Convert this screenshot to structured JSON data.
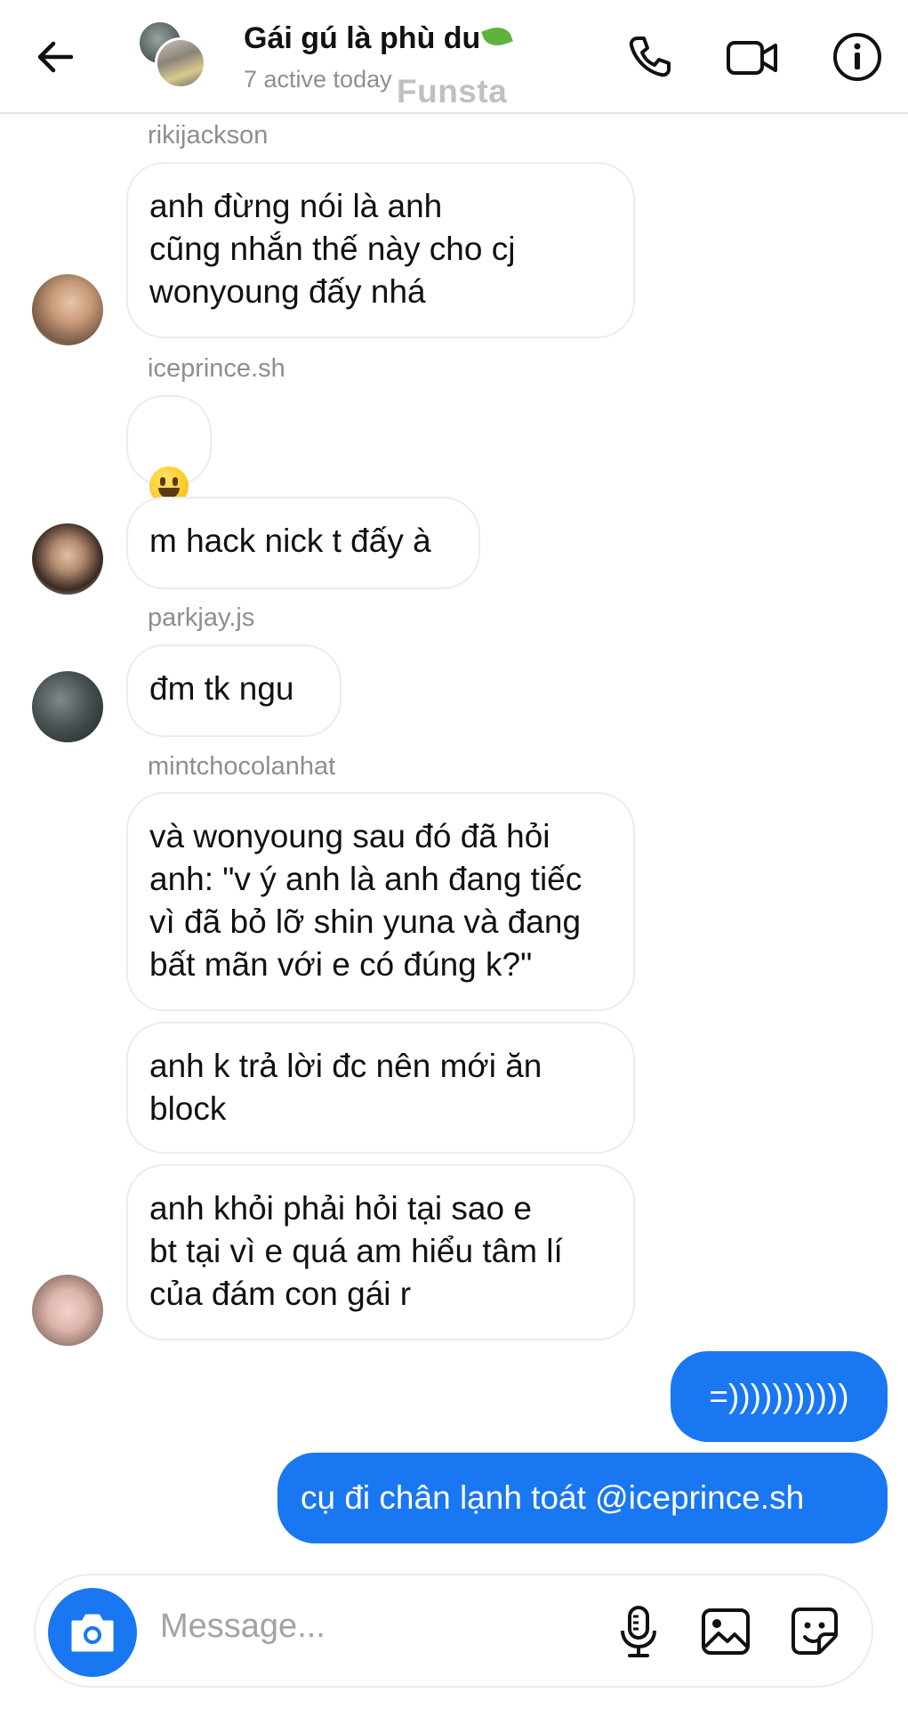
{
  "header": {
    "title": "Gái gú là phù du",
    "subtitle": "7 active today",
    "watermark": "Funsta"
  },
  "messages": {
    "sender1": "rikijackson",
    "msg1": "anh đừng nói là anh\ncũng nhắn thế này cho cj\nwonyoung đấy nhá",
    "sender2": "iceprince.sh",
    "msg3": "m hack nick t đấy à",
    "sender3": "parkjay.js",
    "msg4": "đm tk ngu",
    "sender4": "mintchocolanhat",
    "msg5": "và wonyoung sau đó đã hỏi\nanh: \"v ý anh là anh đang tiếc\nvì đã bỏ lỡ shin yuna và đang\nbất mãn với e có đúng k?\"",
    "msg6": "anh k trả lời đc nên mới ăn\nblock",
    "msg7": "anh khỏi phải hỏi tại sao e\nbt tại vì e quá am hiểu tâm lí\ncủa đám con gái r",
    "out1": "=)))))))))))",
    "out2": "cụ đi chân lạnh toát @iceprince.sh"
  },
  "composer": {
    "placeholder": "Message..."
  },
  "colors": {
    "accent": "#1977f2",
    "bubble_border": "#ececec",
    "muted_text": "#8e8e8e"
  },
  "icons": [
    "back-arrow-icon",
    "phone-icon",
    "video-camera-icon",
    "info-icon",
    "camera-icon",
    "microphone-icon",
    "gallery-icon",
    "sticker-icon",
    "grinning-face-emoji"
  ]
}
